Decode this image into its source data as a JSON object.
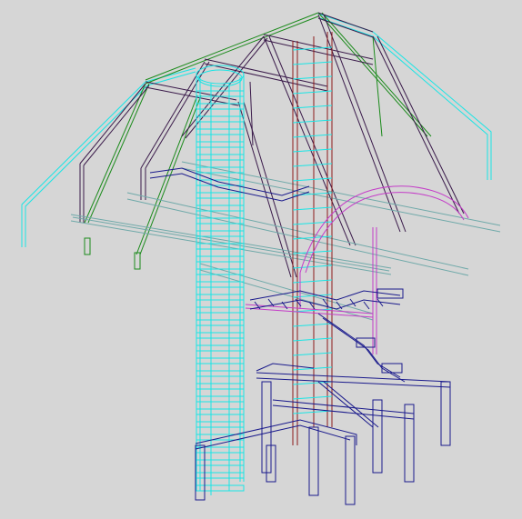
{
  "view": {
    "background": "#d6d6d6",
    "colors": {
      "cyan": "#19e5e5",
      "green": "#1a8a1a",
      "purple": "#3a1a4a",
      "magenta": "#c43cc8",
      "navy": "#1a1a8c",
      "red": "#8c1a1a"
    }
  }
}
